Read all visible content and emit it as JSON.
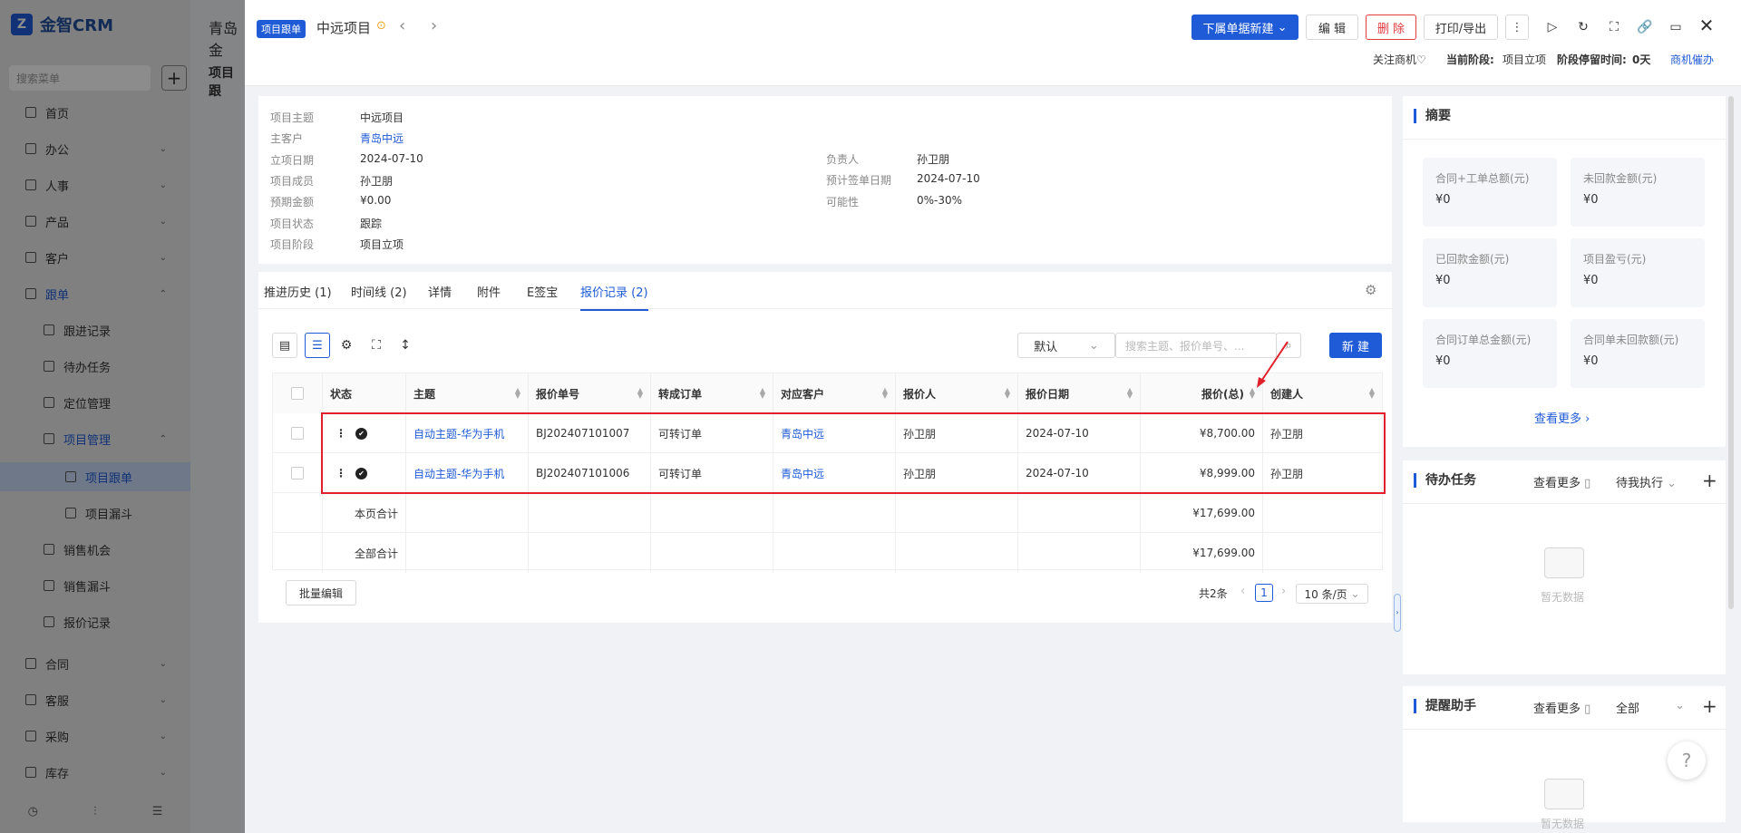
{
  "app": {
    "logo_text": "金智CRM",
    "search_placeholder": "搜索菜单",
    "bg_title": "青岛金",
    "bg_crumb": "项目跟",
    "nav": [
      {
        "label": "首页"
      },
      {
        "label": "办公"
      },
      {
        "label": "人事"
      },
      {
        "label": "产品"
      },
      {
        "label": "客户"
      },
      {
        "label": "跟单"
      },
      {
        "label": "跟进记录"
      },
      {
        "label": "待办任务"
      },
      {
        "label": "定位管理"
      },
      {
        "label": "项目管理"
      },
      {
        "label": "项目跟单"
      },
      {
        "label": "项目漏斗"
      },
      {
        "label": "销售机会"
      },
      {
        "label": "销售漏斗"
      },
      {
        "label": "报价记录"
      },
      {
        "label": "合同"
      },
      {
        "label": "客服"
      },
      {
        "label": "采购"
      },
      {
        "label": "库存"
      }
    ]
  },
  "header": {
    "tag": "项目跟单",
    "title": "中远项目",
    "btn_new_sub": "下属单据新建",
    "btn_edit": "编 辑",
    "btn_delete": "删 除",
    "btn_print": "打印/导出",
    "follow": "关注商机",
    "stage_label": "当前阶段:",
    "stage_value": "项目立项",
    "stay_label": "阶段停留时间:",
    "stay_value": "0天",
    "urge": "商机催办"
  },
  "info": {
    "left": [
      {
        "label": "项目主题",
        "value": "中远项目"
      },
      {
        "label": "主客户",
        "value": "青岛中远"
      },
      {
        "label": "立项日期",
        "value": "2024-07-10"
      },
      {
        "label": "项目成员",
        "value": "孙卫朋"
      },
      {
        "label": "预期金额",
        "value": "¥0.00"
      },
      {
        "label": "项目状态",
        "value": "跟踪"
      },
      {
        "label": "项目阶段",
        "value": "项目立项"
      }
    ],
    "right": [
      {
        "label": "负责人",
        "value": "孙卫朋"
      },
      {
        "label": "预计签单日期",
        "value": "2024-07-10"
      },
      {
        "label": "可能性",
        "value": "0%-30%"
      }
    ]
  },
  "tabs": [
    {
      "label": "推进历史 (1)"
    },
    {
      "label": "时间线 (2)"
    },
    {
      "label": "详情"
    },
    {
      "label": "附件"
    },
    {
      "label": "E签宝"
    },
    {
      "label": "报价记录 (2)"
    }
  ],
  "toolbar": {
    "filter_default": "默认",
    "search_placeholder": "搜索主题、报价单号、...",
    "btn_new": "新 建",
    "btn_batch_edit": "批量编辑"
  },
  "table": {
    "headers": [
      "状态",
      "主题",
      "报价单号",
      "转成订单",
      "对应客户",
      "报价人",
      "报价日期",
      "报价(总)",
      "创建人"
    ],
    "rows": [
      {
        "subject": "自动主题-华为手机",
        "no": "BJ202407101007",
        "order": "可转订单",
        "customer": "青岛中远",
        "quoter": "孙卫朋",
        "date": "2024-07-10",
        "total": "¥8,700.00",
        "creator": "孙卫朋"
      },
      {
        "subject": "自动主题-华为手机",
        "no": "BJ202407101006",
        "order": "可转订单",
        "customer": "青岛中远",
        "quoter": "孙卫朋",
        "date": "2024-07-10",
        "total": "¥8,999.00",
        "creator": "孙卫朋"
      }
    ],
    "page_total_label": "本页合计",
    "page_total_value": "¥17,699.00",
    "all_total_label": "全部合计",
    "all_total_value": "¥17,699.00"
  },
  "pagination": {
    "total": "共2条",
    "page": "1",
    "per_page": "10 条/页"
  },
  "summary": {
    "title": "摘要",
    "cards": [
      {
        "label": "合同+工单总额(元)",
        "value": "¥0"
      },
      {
        "label": "未回款金额(元)",
        "value": "¥0"
      },
      {
        "label": "已回款金额(元)",
        "value": "¥0"
      },
      {
        "label": "项目盈亏(元)",
        "value": "¥0"
      },
      {
        "label": "合同订单总金额(元)",
        "value": "¥0"
      },
      {
        "label": "合同单未回款额(元)",
        "value": "¥0"
      }
    ],
    "more": "查看更多"
  },
  "todo": {
    "title": "待办任务",
    "more": "查看更多",
    "filter": "待我执行",
    "empty": "暂无数据"
  },
  "reminder": {
    "title": "提醒助手",
    "more": "查看更多",
    "filter": "全部",
    "empty": "暂无数据"
  },
  "colors": {
    "accent": "#1f5bd6",
    "danger": "#e23c3c",
    "highlight_box": "#e0212b"
  }
}
